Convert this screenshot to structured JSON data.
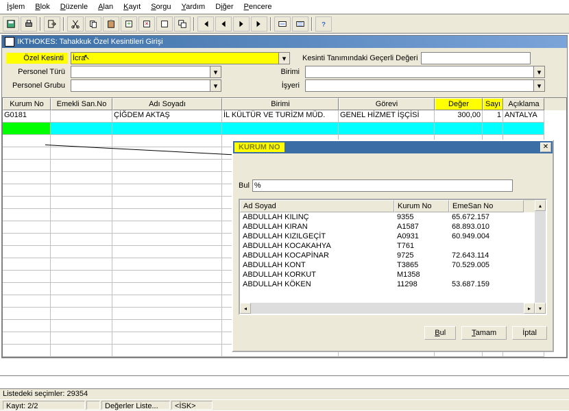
{
  "menu": [
    "İşlem",
    "Blok",
    "Düzenle",
    "Alan",
    "Kayıt",
    "Sorgu",
    "Yardım",
    "Diğer",
    "Pencere"
  ],
  "window_title": "IKTHOKES: Tahakkuk Özel Kesintileri Girişi",
  "form": {
    "ozel_kesinti_label": "Özel Kesinti",
    "ozel_kesinti_value": "İcra",
    "kesinti_tanim_label": "Kesinti Tanımındaki Geçerli Değeri",
    "kesinti_tanim_value": "",
    "personel_turu_label": "Personel Türü",
    "personel_grubu_label": "Personel  Grubu",
    "birimi_label": "Birimi",
    "isyeri_label": "İşyeri"
  },
  "grid": {
    "headers": [
      "Kurum No",
      "Emekli San.No",
      "Adı Soyadı",
      "Birimi",
      "Görevi",
      "Değer",
      "Sayı",
      "Açıklama"
    ],
    "row": {
      "kurum_no": "G0181",
      "emekli": "",
      "adi": "ÇİĞDEM AKTAŞ",
      "birimi": "İL KÜLTÜR VE TURİZM MÜD.",
      "gorevi": "GENEL HİZMET İŞÇİSİ",
      "deger": "300,00",
      "sayi": "1",
      "aciklama": "ANTALYA"
    }
  },
  "popup": {
    "title": "KURUM NO",
    "find_label": "Bul",
    "find_value": "%",
    "headers": [
      "Ad Soyad",
      "Kurum No",
      "EmeSan No"
    ],
    "rows": [
      {
        "ad": "ABDULLAH KILINÇ",
        "kurum": "9355",
        "eme": "65.672.157"
      },
      {
        "ad": "ABDULLAH KIRAN",
        "kurum": "A1587",
        "eme": "68.893.010"
      },
      {
        "ad": "ABDULLAH KIZILGEÇİT",
        "kurum": "A0931",
        "eme": "60.949.004"
      },
      {
        "ad": "ABDULLAH KOCAKAHYA",
        "kurum": "T761",
        "eme": ""
      },
      {
        "ad": "ABDULLAH KOCAPİNAR",
        "kurum": "9725",
        "eme": "72.643.114"
      },
      {
        "ad": "ABDULLAH KONT",
        "kurum": "T3865",
        "eme": "70.529.005"
      },
      {
        "ad": "ABDULLAH KORKUT",
        "kurum": "M1358",
        "eme": ""
      },
      {
        "ad": "ABDULLAH KÖKEN",
        "kurum": "11298",
        "eme": "53.687.159"
      }
    ],
    "btn_bul": "Bul",
    "btn_tamam": "Tamam",
    "btn_iptal": "İptal"
  },
  "status": {
    "list_count": "Listedeki seçimler: 29354",
    "kayit": "Kayıt: 2/2",
    "mode": "Değerler Liste...",
    "context": "<İSK>"
  }
}
